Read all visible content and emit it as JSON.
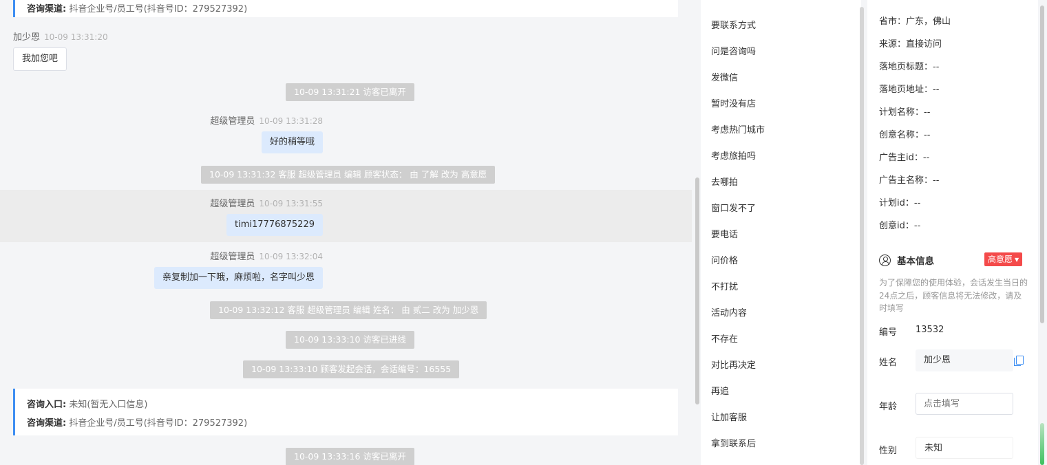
{
  "chat": {
    "top_card": {
      "channel_label": "咨询渠道:",
      "channel_value": "抖音企业号/员工号(抖音号ID：279527392)"
    },
    "messages": [
      {
        "sender": "加少恩",
        "time": "10-09 13:31:20",
        "text": "我加您吧"
      },
      {
        "system": "10-09 13:31:21 访客已离开"
      },
      {
        "sender": "超级管理员",
        "time": "10-09 13:31:28",
        "text": "好的稍等哦"
      },
      {
        "system": "10-09 13:31:32 客服 超级管理员 编辑 顾客状态： 由 了解 改为 高意愿"
      },
      {
        "sender": "超级管理员",
        "time": "10-09 13:31:55",
        "text": "timi17776875229"
      },
      {
        "sender": "超级管理员",
        "time": "10-09 13:32:04",
        "text": "亲复制加一下哦，麻烦啦，名字叫少恩"
      },
      {
        "system": "10-09 13:32:12 客服 超级管理员 编辑 姓名： 由 贰二 改为 加少恩"
      },
      {
        "system": "10-09 13:33:10 访客已进线"
      },
      {
        "system": "10-09 13:33:10 顾客发起会话，会话编号：16555"
      },
      {
        "system": "10-09 13:33:16 访客已离开"
      }
    ],
    "entry_card": {
      "entry_label": "咨询入口:",
      "entry_value": "未知(暂无入口信息)",
      "channel_label": "咨询渠道:",
      "channel_value": "抖音企业号/员工号(抖音号ID：279527392)"
    }
  },
  "quick_replies": [
    "要联系方式",
    "问是咨询吗",
    "发微信",
    "暂时没有店",
    "考虑热门城市",
    "考虑旅拍吗",
    "去哪拍",
    "窗口发不了",
    "要电话",
    "问价格",
    "不打扰",
    "活动内容",
    "不存在",
    "对比再决定",
    "再追",
    "让加客服",
    "拿到联系后"
  ],
  "visitor_info": [
    {
      "label": "省市：",
      "value": "广东，佛山"
    },
    {
      "label": "来源：",
      "value": "直接访问"
    },
    {
      "label": "落地页标题：",
      "value": "--"
    },
    {
      "label": "落地页地址：",
      "value": "--"
    },
    {
      "label": "计划名称：",
      "value": "--"
    },
    {
      "label": "创意名称：",
      "value": "--"
    },
    {
      "label": "广告主id：",
      "value": "--"
    },
    {
      "label": "广告主名称：",
      "value": "--"
    },
    {
      "label": "计划id：",
      "value": "--"
    },
    {
      "label": "创意id：",
      "value": "--"
    }
  ],
  "basic_info": {
    "title": "基本信息",
    "intent_badge": "高意愿",
    "notice": "为了保障您的使用体验，会话发生当日的24点之后，顾客信息将无法修改，请及时填写",
    "id_label": "编号",
    "id_value": "13532",
    "name_label": "姓名",
    "name_value": "加少恩",
    "age_label": "年龄",
    "age_placeholder": "点击填写",
    "gender_label": "性别",
    "gender_value": "未知"
  },
  "colors": {
    "accent": "#3d8ef2",
    "badge": "#f44a4a",
    "agent_bubble": "#dceafd"
  }
}
